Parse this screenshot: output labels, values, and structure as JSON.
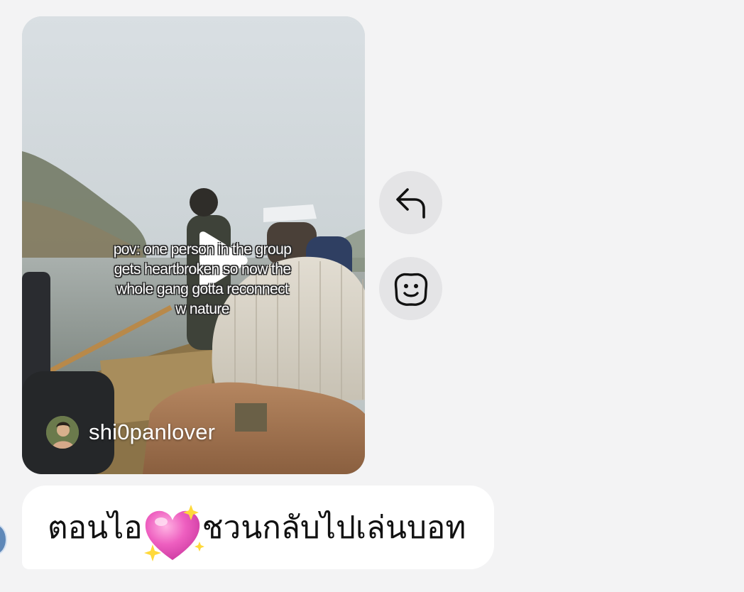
{
  "shared_post": {
    "caption": "pov: one person in the group\ngets heartbroken so now the\nwhole gang gotta reconnect\nw nature",
    "author": "shi0panlover",
    "play_icon": "play-icon"
  },
  "actions": {
    "reply_icon": "reply-arrow-icon",
    "react_icon": "emoji-react-icon"
  },
  "message": {
    "text_before": "ตอนไอ",
    "emoji": "sparkling-heart",
    "text_after": "ชวนกลับไปเล่นบอท"
  },
  "colors": {
    "background": "#f3f3f4",
    "bubble": "#ffffff",
    "action_button": "#e4e4e6",
    "emoji_heart": "#e84bb3"
  }
}
